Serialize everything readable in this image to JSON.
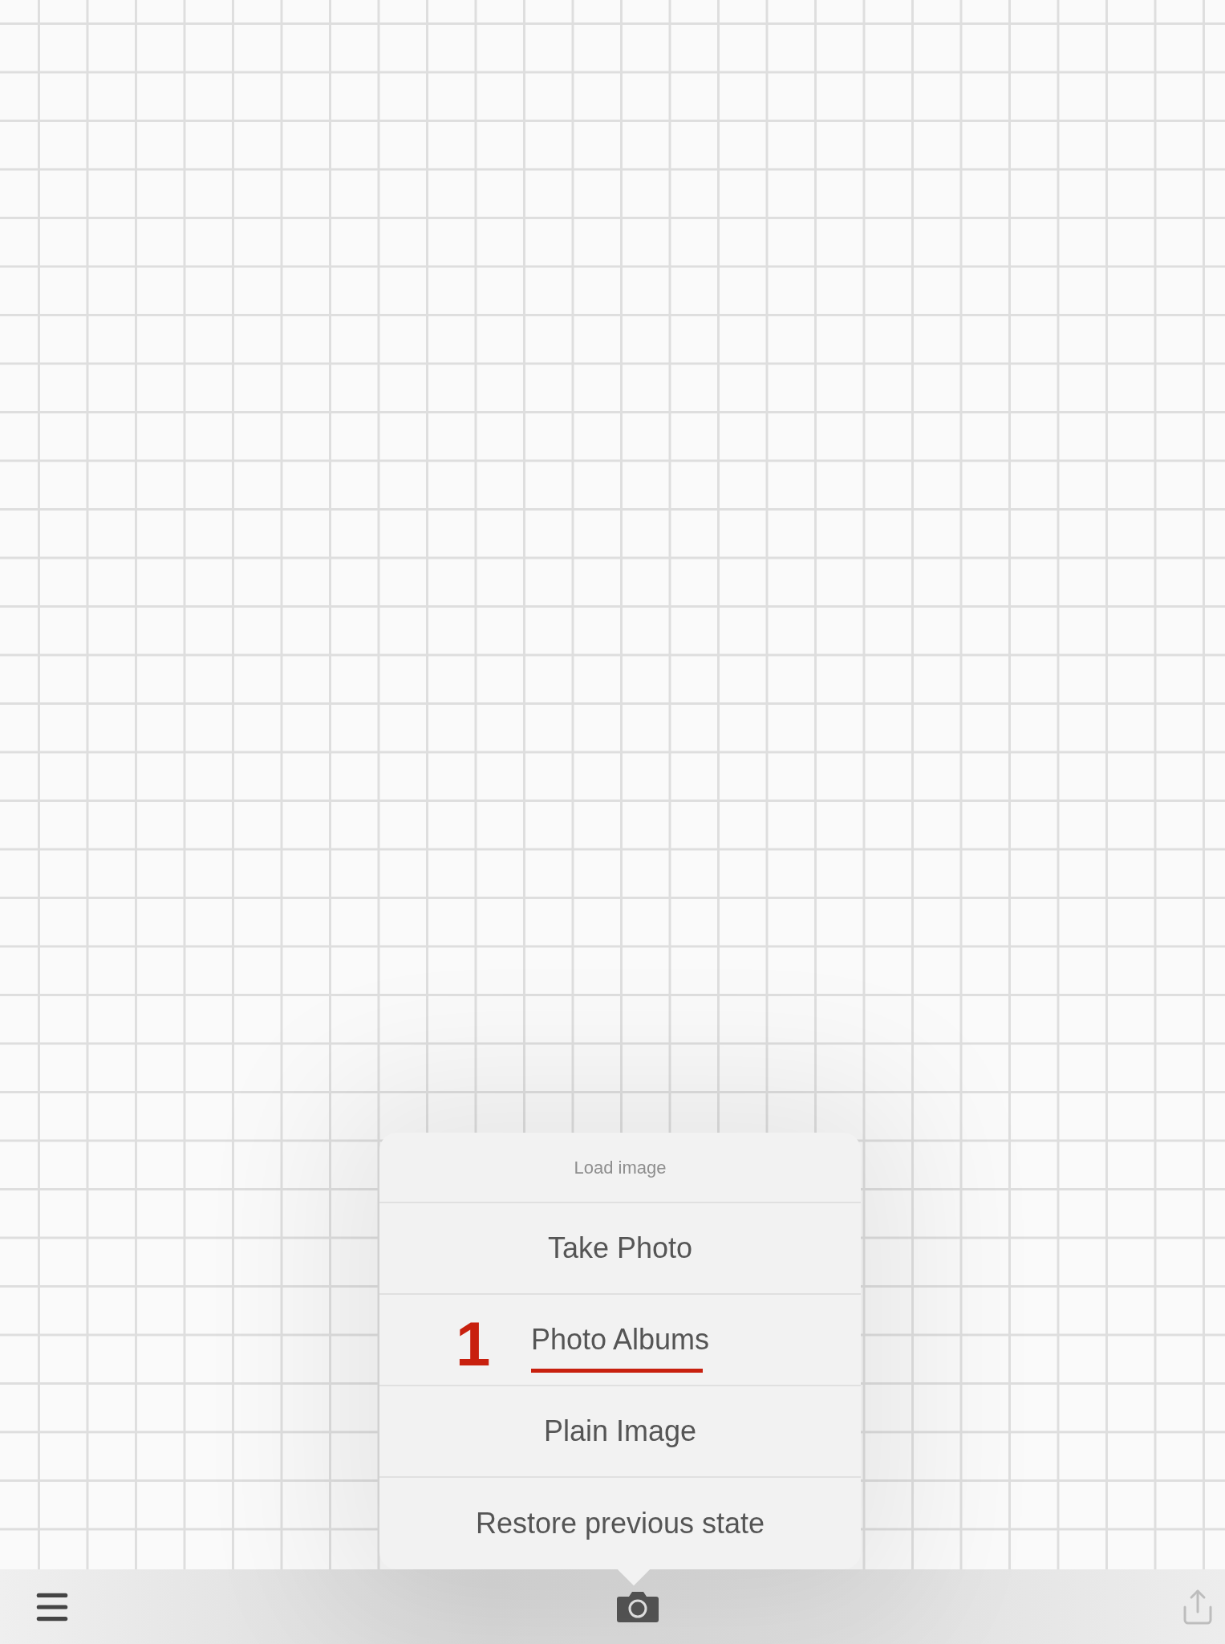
{
  "popover": {
    "title": "Load image",
    "items": [
      {
        "label": "Take Photo"
      },
      {
        "label": "Photo Albums",
        "annotation": "1"
      },
      {
        "label": "Plain Image"
      },
      {
        "label": "Restore previous state"
      }
    ]
  }
}
